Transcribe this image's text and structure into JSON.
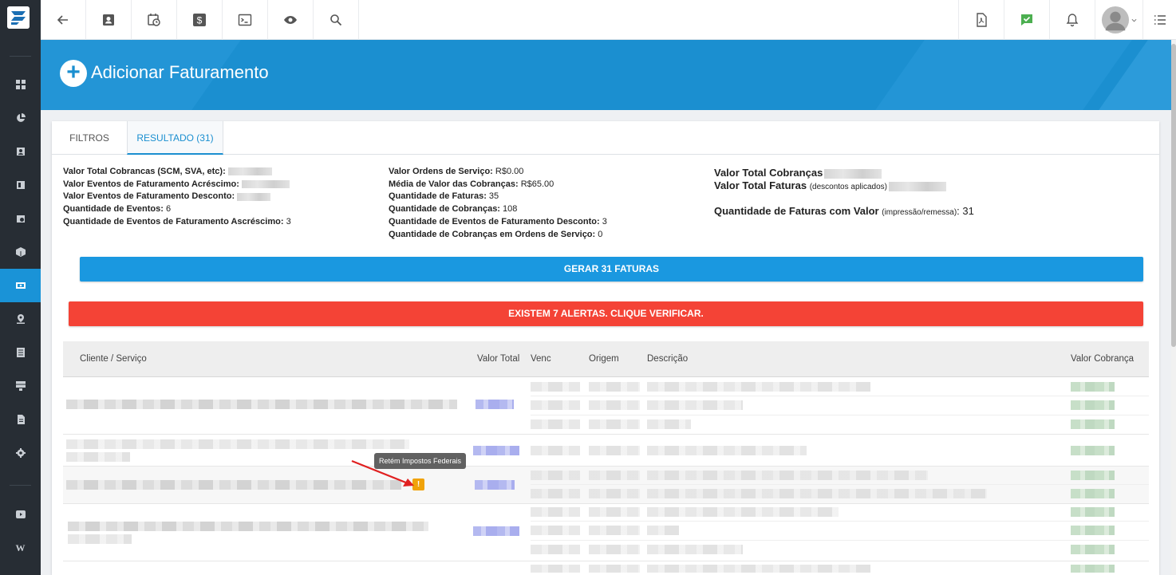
{
  "app": {
    "accent": "#1b8fd0",
    "danger": "#f44336"
  },
  "sidebar": {
    "items": [
      {
        "icon": "dashboard-icon"
      },
      {
        "icon": "pie-chart-icon"
      },
      {
        "icon": "contact-card-icon"
      },
      {
        "icon": "map-book-icon"
      },
      {
        "icon": "calendar-clock-icon"
      },
      {
        "icon": "package-icon"
      },
      {
        "icon": "billing-icon",
        "active": true
      },
      {
        "icon": "location-icon"
      },
      {
        "icon": "list-document-icon"
      },
      {
        "icon": "server-icon"
      },
      {
        "icon": "file-icon"
      },
      {
        "icon": "settings-icon"
      },
      {
        "icon": "video-icon"
      },
      {
        "label": "W"
      }
    ]
  },
  "topbar": {
    "icons": [
      "back-arrow-icon",
      "contact-icon",
      "calendar-clock-icon",
      "dollar-icon",
      "terminal-icon",
      "eye-icon",
      "search-icon",
      "pdf-icon",
      "chat-check-icon",
      "bell-icon",
      "avatar",
      "menu-list-icon"
    ]
  },
  "header": {
    "title": "Adicionar Faturamento"
  },
  "tabs": [
    {
      "label": "FILTROS",
      "active": false
    },
    {
      "label": "RESULTADO (31)",
      "active": true
    }
  ],
  "summary": {
    "col1": [
      {
        "label": "Valor Total Cobrancas (SCM, SVA, etc):",
        "value": ""
      },
      {
        "label": "Valor Eventos de Faturamento Acréscimo:",
        "value": ""
      },
      {
        "label": "Valor Eventos de Faturamento Desconto:",
        "value": ""
      },
      {
        "label": "Quantidade de Eventos:",
        "value": "6"
      },
      {
        "label": "Quantidade de Eventos de Faturamento Ascréscimo:",
        "value": "3"
      }
    ],
    "col2": [
      {
        "label": "Valor Ordens de Serviço:",
        "value": "R$0.00"
      },
      {
        "label": "Média de Valor das Cobranças:",
        "value": "R$65.00"
      },
      {
        "label": "Quantidade de Faturas:",
        "value": "35"
      },
      {
        "label": "Quantidade de Cobranças:",
        "value": "108"
      },
      {
        "label": "Quantidade de Eventos de Faturamento Desconto:",
        "value": "3"
      },
      {
        "label": "Quantidade de Cobranças em Ordens de Serviço:",
        "value": "0"
      }
    ],
    "col3": {
      "total_cobrancas_label": "Valor Total Cobranças",
      "total_faturas_label": "Valor Total Faturas",
      "total_faturas_note": "(descontos aplicados)",
      "qtd_faturas_label": "Quantidade de Faturas com Valor",
      "qtd_faturas_note": "(impressão/remessa)",
      "qtd_faturas_value": "31"
    }
  },
  "actions": {
    "generate_label": "GERAR 31 FATURAS",
    "alerts_label": "EXISTEM 7 ALERTAS. CLIQUE VERIFICAR."
  },
  "table": {
    "columns": [
      "Cliente / Serviço",
      "Valor Total",
      "Venc",
      "Origem",
      "Descrição",
      "Valor Cobrança"
    ]
  },
  "tooltip": {
    "text": "Retém Impostos Federais"
  }
}
